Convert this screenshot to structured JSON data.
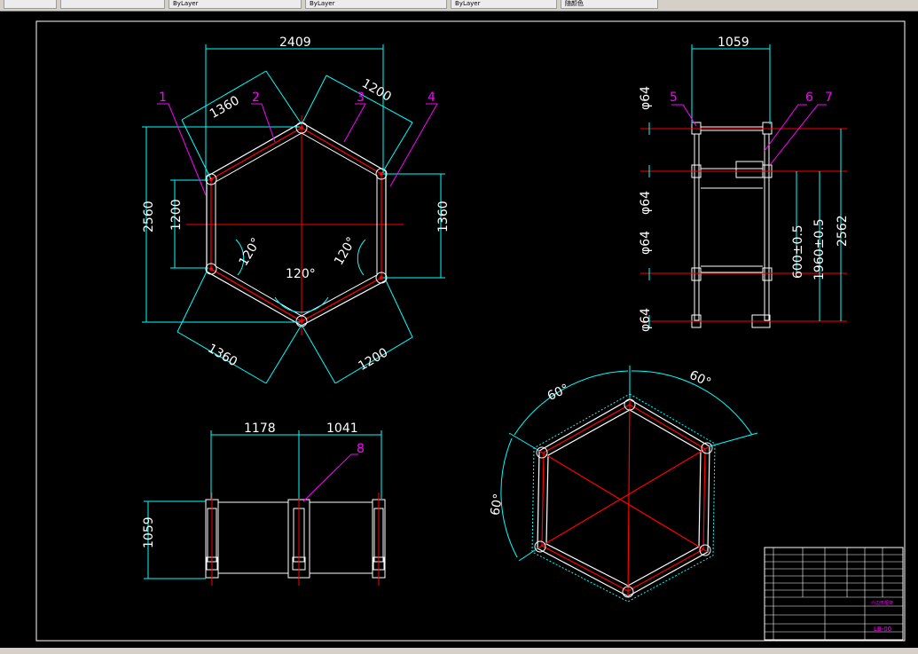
{
  "toolbar": {
    "tabs": [
      "",
      "",
      "ByLayer",
      "ByLayer",
      "ByLayer",
      "随颜色"
    ]
  },
  "colors": {
    "background": "#000000",
    "border": "#ffffff",
    "dimension": "#00ffff",
    "centerline": "#ff0000",
    "leader": "#ff00ff",
    "part": "#ffffff"
  },
  "top_view": {
    "dims": [
      "2409",
      "1360",
      "1200",
      "2560",
      "1200",
      "1360",
      "1360",
      "1200"
    ],
    "angles": [
      "120°",
      "120°",
      "120°"
    ],
    "callouts": [
      "1",
      "2",
      "3",
      "4"
    ]
  },
  "side_view": {
    "dims": [
      "1059",
      "2562"
    ],
    "diameters": [
      "φ64",
      "φ64",
      "φ64",
      "φ64"
    ],
    "toleranced": [
      "600±0.5",
      "1960±0.5"
    ],
    "callouts": [
      "5",
      "6",
      "7"
    ]
  },
  "front_view": {
    "dims": [
      "1178",
      "1041",
      "1059"
    ],
    "callouts": [
      "8"
    ]
  },
  "iso_view": {
    "angles": [
      "60°",
      "60°",
      "60°"
    ]
  },
  "title_block": {
    "part_name": "六边形框架",
    "drawing_no": "LB-00"
  }
}
